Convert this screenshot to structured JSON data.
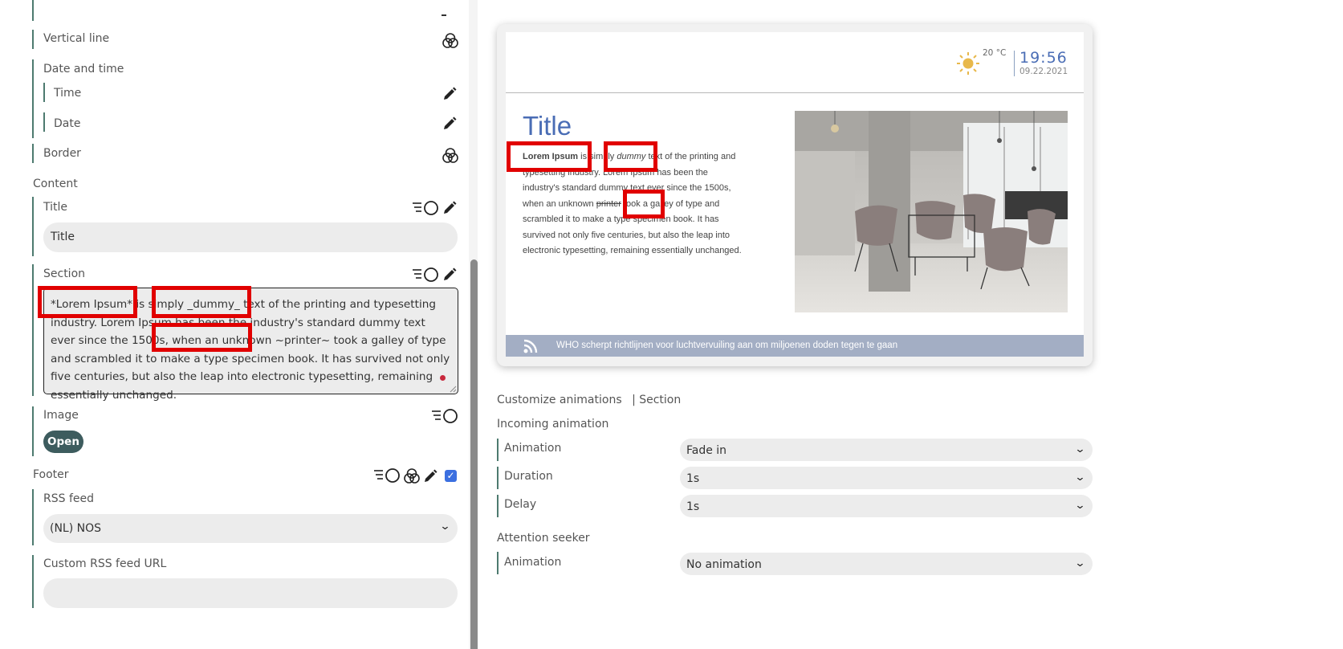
{
  "editor": {
    "vertical_line": "Vertical line",
    "date_and_time": "Date and time",
    "time": "Time",
    "date": "Date",
    "border": "Border",
    "content": "Content",
    "title_label": "Title",
    "title_value": "Title",
    "section_label": "Section",
    "section_text": "*Lorem  Ipsum* is simply _dummy_ text of the printing and typesetting industry. Lorem  Ipsum has been the industry's standard dummy text ever since the 1500s, when an unknown ~printer~ took a galley of type and scrambled it to make a type specimen book.  It has survived not only five centuries, but also the leap into electronic typesetting, remaining essentially unchanged.",
    "image_label": "Image",
    "open_button": "Open",
    "footer": "Footer",
    "rss_feed_label": "RSS feed",
    "rss_feed_value": "(NL)  NOS",
    "custom_rss_label": "Custom  RSS feed URL",
    "custom_rss_value": "",
    "footer_checked": true
  },
  "preview": {
    "temperature": "20 °C",
    "time": "19:56",
    "date": "09.22.2021",
    "title": "Title",
    "body_bold": "Lorem Ipsum",
    "body_1": " is simply ",
    "body_italic": "dummy",
    "body_2": " text of the printing and typesetting industry. Lorem Ipsum has been the industry's standard dummy text ever since the 1500s, when an unknown ",
    "body_strike": "printer",
    "body_3": " took a galley of type and scrambled it to make a type specimen book. It has survived not only five centuries, but also the leap into electronic typesetting, remaining essentially unchanged.",
    "ticker": "WHO scherpt richtlijnen voor luchtvervuiling aan om miljoenen doden tegen te gaan"
  },
  "animations": {
    "heading": "Customize animations",
    "heading_sub": "| Section",
    "incoming": "Incoming animation",
    "animation_label": "Animation",
    "animation_value": "Fade in",
    "duration_label": "Duration",
    "duration_value": "1s",
    "delay_label": "Delay",
    "delay_value": "1s",
    "attention": "Attention seeker",
    "attention_animation_label": "Animation",
    "attention_animation_value": "No animation"
  },
  "colors": {
    "accent_bar": "#4d7a6f",
    "open_button": "#3d5c5e",
    "preview_title": "#4a6db5",
    "ticker_bar": "#a3aec4",
    "highlight": "#e10000"
  }
}
